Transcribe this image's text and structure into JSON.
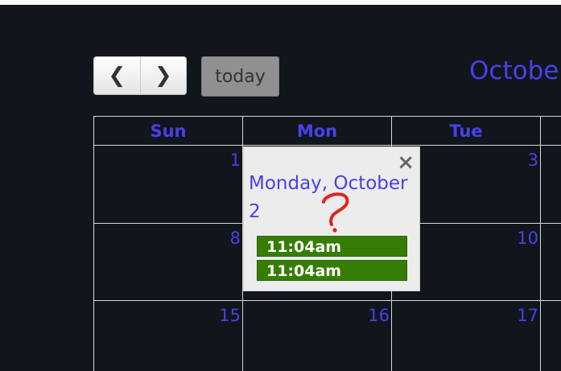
{
  "toolbar": {
    "prev_glyph": "❮",
    "next_glyph": "❯",
    "today_label": "today",
    "title": "Octobe"
  },
  "days_header": [
    "Sun",
    "Mon",
    "Tue"
  ],
  "weeks": [
    {
      "dates": [
        "1",
        "",
        "3"
      ]
    },
    {
      "dates": [
        "8",
        "",
        "10"
      ]
    },
    {
      "dates": [
        "15",
        "16",
        "17"
      ]
    }
  ],
  "popover": {
    "title": "Monday, October 2",
    "close_glyph": "×",
    "events": [
      {
        "time": "11:04am"
      },
      {
        "time": "11:04am"
      }
    ]
  },
  "colors": {
    "background": "#11151c",
    "accent": "#4741ea",
    "event": "#367d05",
    "annotation": "#e0241f"
  },
  "icons": {
    "prev": "chevron-left-icon",
    "next": "chevron-right-icon",
    "close": "close-icon",
    "annotation": "question-mark-annotation"
  }
}
